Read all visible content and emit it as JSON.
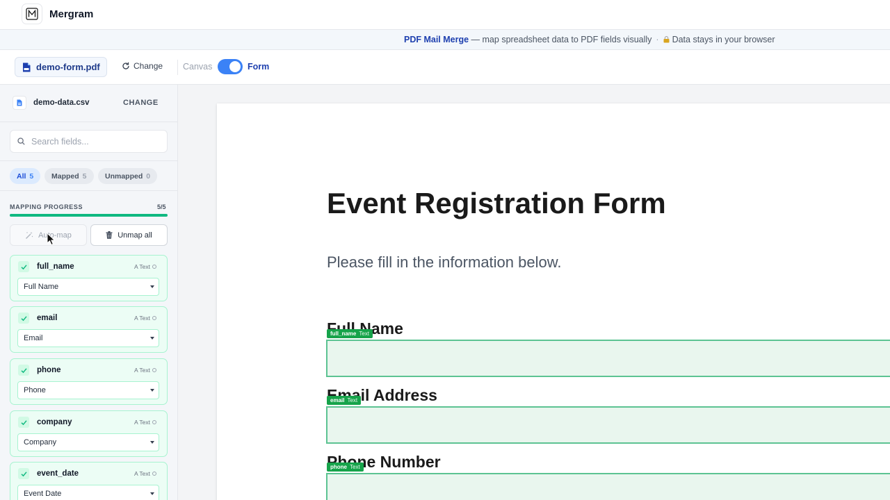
{
  "app": {
    "name": "Mergram"
  },
  "banner": {
    "brand": "PDF Mail Merge",
    "tagline": " — map spreadsheet data to PDF fields visually",
    "separator": "·",
    "privacy": "Data stays in your browser"
  },
  "toolbar": {
    "pdf_file": "demo-form.pdf",
    "change_label": "Change",
    "canvas_label": "Canvas",
    "form_label": "Form",
    "view_mode": "Form"
  },
  "sidebar": {
    "csv_file": "demo-data.csv",
    "csv_change": "CHANGE",
    "search_placeholder": "Search fields...",
    "filters": [
      {
        "label": "All",
        "count": "5",
        "active": true
      },
      {
        "label": "Mapped",
        "count": "5",
        "active": false
      },
      {
        "label": "Unmapped",
        "count": "0",
        "active": false
      }
    ],
    "progress_label": "MAPPING PROGRESS",
    "progress_count": "5/5",
    "progress_fraction": 1.0,
    "auto_map_label": "Auto-map",
    "unmap_all_label": "Unmap all",
    "fields": [
      {
        "name": "full_name",
        "type": "Text",
        "mapped_to": "Full Name"
      },
      {
        "name": "email",
        "type": "Text",
        "mapped_to": "Email"
      },
      {
        "name": "phone",
        "type": "Text",
        "mapped_to": "Phone"
      },
      {
        "name": "company",
        "type": "Text",
        "mapped_to": "Company"
      },
      {
        "name": "event_date",
        "type": "Text",
        "mapped_to": "Event Date"
      }
    ]
  },
  "document": {
    "title": "Event Registration Form",
    "subtitle": "Please fill in the information below.",
    "fields": [
      {
        "label": "Full Name",
        "tag_name": "full_name",
        "tag_type": "Text"
      },
      {
        "label": "Email Address",
        "tag_name": "email",
        "tag_type": "Text"
      },
      {
        "label": "Phone Number",
        "tag_name": "phone",
        "tag_type": "Text"
      }
    ]
  },
  "colors": {
    "accent": "#3b82f6",
    "mapped_green": "#10b981",
    "brand_blue": "#1e40af"
  }
}
